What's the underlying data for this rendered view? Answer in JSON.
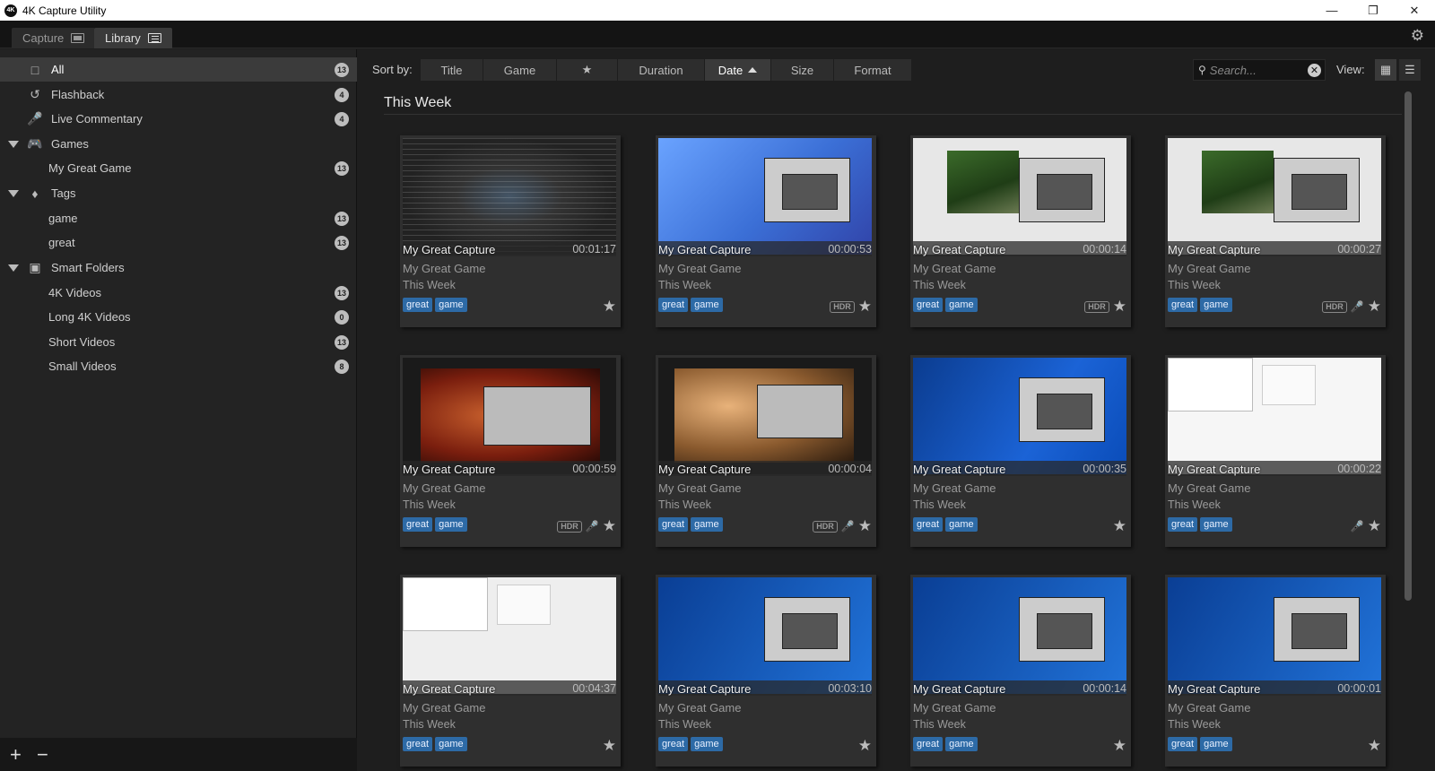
{
  "window": {
    "title": "4K Capture Utility",
    "app_icon_text": "4K"
  },
  "tabs": [
    {
      "label": "Capture",
      "icon": "screen-icon"
    },
    {
      "label": "Library",
      "icon": "grid-icon"
    }
  ],
  "sidebar": {
    "items": [
      {
        "label": "All",
        "icon": "all-icon",
        "count": "13"
      },
      {
        "label": "Flashback",
        "icon": "flashback-icon",
        "count": "4"
      },
      {
        "label": "Live Commentary",
        "icon": "mic-icon",
        "count": "4"
      },
      {
        "label": "Games",
        "icon": "gamepad-icon",
        "count": ""
      },
      {
        "label": "My Great Game",
        "icon": "",
        "count": "13"
      },
      {
        "label": "Tags",
        "icon": "tag-icon",
        "count": ""
      },
      {
        "label": "game",
        "icon": "",
        "count": "13"
      },
      {
        "label": "great",
        "icon": "",
        "count": "13"
      },
      {
        "label": "Smart Folders",
        "icon": "smart-folder-icon",
        "count": ""
      },
      {
        "label": "4K Videos",
        "icon": "",
        "count": "13"
      },
      {
        "label": "Long 4K Videos",
        "icon": "",
        "count": "0"
      },
      {
        "label": "Short Videos",
        "icon": "",
        "count": "13"
      },
      {
        "label": "Small Videos",
        "icon": "",
        "count": "8"
      }
    ],
    "add": "+",
    "remove": "−"
  },
  "sortbar": {
    "label": "Sort by:",
    "options": [
      "Title",
      "Game",
      "★",
      "Duration",
      "Date",
      "Size",
      "Format"
    ],
    "active": "Date"
  },
  "search": {
    "placeholder": "Search..."
  },
  "view": {
    "label": "View:"
  },
  "section": {
    "title": "This Week"
  },
  "cards": [
    {
      "title": "My Great Capture",
      "duration": "00:01:17",
      "game": "My Great Game",
      "week": "This Week",
      "tags": [
        "great",
        "game"
      ],
      "hdr": "",
      "mic": false
    },
    {
      "title": "My Great Capture",
      "duration": "00:00:53",
      "game": "My Great Game",
      "week": "This Week",
      "tags": [
        "great",
        "game"
      ],
      "hdr": "HDR",
      "mic": false
    },
    {
      "title": "My Great Capture",
      "duration": "00:00:14",
      "game": "My Great Game",
      "week": "This Week",
      "tags": [
        "great",
        "game"
      ],
      "hdr": "HDR",
      "mic": false
    },
    {
      "title": "My Great Capture",
      "duration": "00:00:27",
      "game": "My Great Game",
      "week": "This Week",
      "tags": [
        "great",
        "game"
      ],
      "hdr": "HDR",
      "mic": true
    },
    {
      "title": "My Great Capture",
      "duration": "00:00:59",
      "game": "My Great Game",
      "week": "This Week",
      "tags": [
        "great",
        "game"
      ],
      "hdr": "HDR",
      "mic": true
    },
    {
      "title": "My Great Capture",
      "duration": "00:00:04",
      "game": "My Great Game",
      "week": "This Week",
      "tags": [
        "great",
        "game"
      ],
      "hdr": "HDR",
      "mic": true
    },
    {
      "title": "My Great Capture",
      "duration": "00:00:35",
      "game": "My Great Game",
      "week": "This Week",
      "tags": [
        "great",
        "game"
      ],
      "hdr": "",
      "mic": false
    },
    {
      "title": "My Great Capture",
      "duration": "00:00:22",
      "game": "My Great Game",
      "week": "This Week",
      "tags": [
        "great",
        "game"
      ],
      "hdr": "",
      "mic": true
    },
    {
      "title": "My Great Capture",
      "duration": "00:04:37",
      "game": "My Great Game",
      "week": "This Week",
      "tags": [
        "great",
        "game"
      ],
      "hdr": "",
      "mic": false
    },
    {
      "title": "My Great Capture",
      "duration": "00:03:10",
      "game": "My Great Game",
      "week": "This Week",
      "tags": [
        "great",
        "game"
      ],
      "hdr": "",
      "mic": false
    },
    {
      "title": "My Great Capture",
      "duration": "00:00:14",
      "game": "My Great Game",
      "week": "This Week",
      "tags": [
        "great",
        "game"
      ],
      "hdr": "",
      "mic": false
    },
    {
      "title": "My Great Capture",
      "duration": "00:00:01",
      "game": "My Great Game",
      "week": "This Week",
      "tags": [
        "great",
        "game"
      ],
      "hdr": "",
      "mic": false
    }
  ]
}
